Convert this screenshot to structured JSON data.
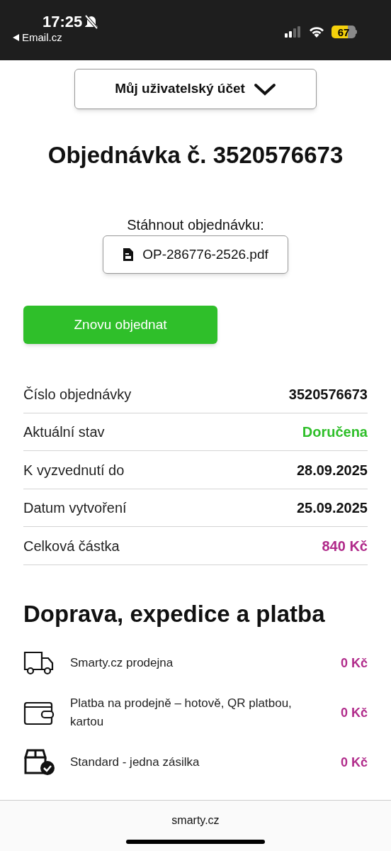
{
  "status_bar": {
    "time": "17:25",
    "back_app": "Email.cz",
    "battery": "67"
  },
  "account_menu": {
    "label": "Můj uživatelský účet"
  },
  "title": "Objednávka č. 3520576673",
  "download": {
    "label": "Stáhnout objednávku:",
    "file": "OP-286776-2526.pdf"
  },
  "reorder_button": "Znovu objednat",
  "details": [
    {
      "label": "Číslo objednávky",
      "value": "3520576673",
      "kind": "plain"
    },
    {
      "label": "Aktuální stav",
      "value": "Doručena",
      "kind": "status"
    },
    {
      "label": "K vyzvednutí do",
      "value": "28.09.2025",
      "kind": "plain"
    },
    {
      "label": "Datum vytvoření",
      "value": "25.09.2025",
      "kind": "plain"
    },
    {
      "label": "Celková částka",
      "value": "840 Kč",
      "kind": "price"
    }
  ],
  "shipping": {
    "title": "Doprava, expedice a platba",
    "items": [
      {
        "kind": "delivery",
        "label": "Smarty.cz prodejna",
        "price": "0 Kč"
      },
      {
        "kind": "payment",
        "label": "Platba na prodejně – hotově, QR platbou, kartou",
        "price": "0 Kč"
      },
      {
        "kind": "package",
        "label": "Standard - jedna zásilka",
        "price": "0 Kč"
      }
    ]
  },
  "footer": {
    "domain": "smarty.cz"
  }
}
